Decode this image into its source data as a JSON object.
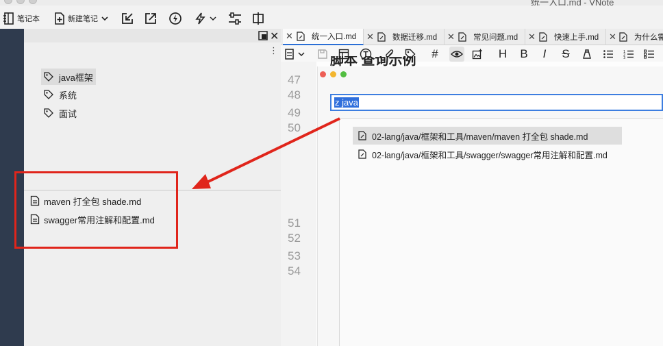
{
  "window": {
    "title": "统一入口.md - VNote"
  },
  "toolbar": {
    "notebook_label": "笔记本",
    "new_note_label": "新建笔记"
  },
  "tags": [
    {
      "label": "java框架",
      "selected": true
    },
    {
      "label": "系统",
      "selected": false
    },
    {
      "label": "面试",
      "selected": false
    }
  ],
  "files": [
    {
      "label": "maven 打全包 shade.md"
    },
    {
      "label": "swagger常用注解和配置.md"
    }
  ],
  "tabs": [
    {
      "label": "统一入口.md",
      "active": true
    },
    {
      "label": "数据迁移.md",
      "active": false
    },
    {
      "label": "常见问题.md",
      "active": false
    },
    {
      "label": "快速上手.md",
      "active": false
    },
    {
      "label": "为什么需",
      "active": false
    }
  ],
  "editor": {
    "heading": "脚本 查询示例",
    "line_numbers": [
      "47",
      "48",
      "49",
      "50",
      "51",
      "52",
      "53",
      "54"
    ]
  },
  "search": {
    "query": "z java",
    "results": [
      {
        "path": "02-lang/java/框架和工具/maven/maven 打全包 shade.md",
        "selected": true
      },
      {
        "path": "02-lang/java/框架和工具/swagger/swagger常用注解和配置.md",
        "selected": false
      }
    ]
  },
  "colors": {
    "annotation": "#e0251b",
    "accent": "#2f6fdc",
    "sidebar_dark": "#2f3b4e"
  },
  "icons": {
    "tag": "tag-icon",
    "file": "file-icon",
    "close": "close-icon"
  }
}
